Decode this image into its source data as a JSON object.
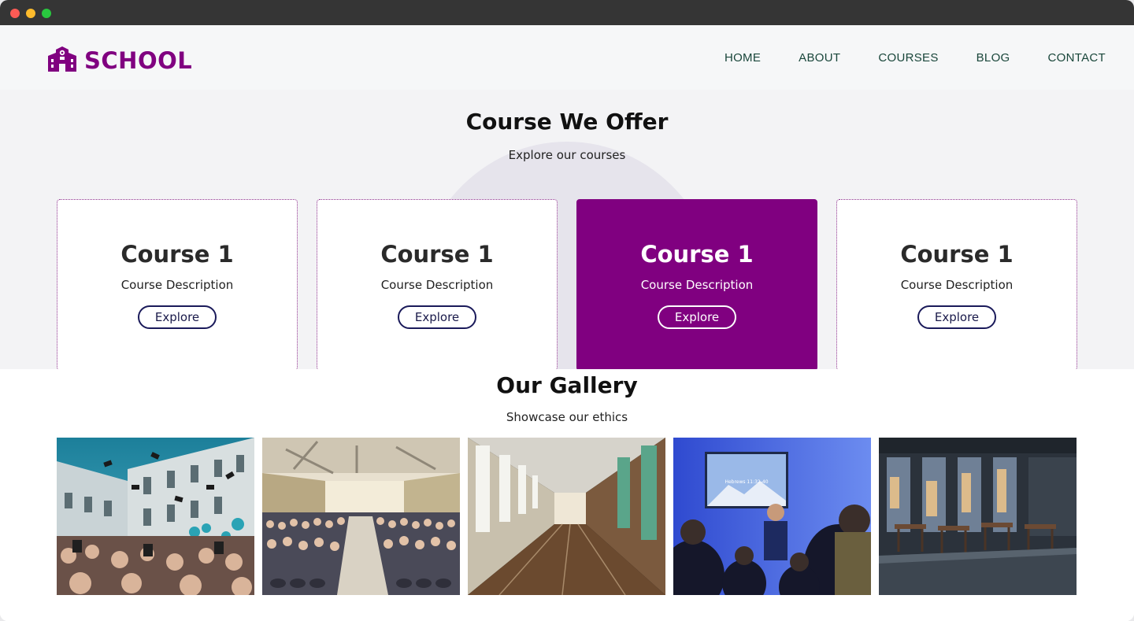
{
  "header": {
    "logo_text": "SCHOOL",
    "nav": [
      "HOME",
      "ABOUT",
      "COURSES",
      "BLOG",
      "CONTACT"
    ]
  },
  "courses": {
    "title": "Course We Offer",
    "subtitle": "Explore our courses",
    "cards": [
      {
        "title": "Course 1",
        "description": "Course Description",
        "button": "Explore",
        "active": false
      },
      {
        "title": "Course 1",
        "description": "Course Description",
        "button": "Explore",
        "active": false
      },
      {
        "title": "Course 1",
        "description": "Course Description",
        "button": "Explore",
        "active": true
      },
      {
        "title": "Course 1",
        "description": "Course Description",
        "button": "Explore",
        "active": false
      }
    ]
  },
  "gallery": {
    "title": "Our Gallery",
    "subtitle": "Showcase our ethics",
    "photos": [
      {
        "name": "graduation-photo",
        "slide_text": ""
      },
      {
        "name": "auditorium-photo",
        "slide_text": ""
      },
      {
        "name": "hallway-photo",
        "slide_text": ""
      },
      {
        "name": "presentation-photo",
        "slide_text": "Hebrews 11:32-40"
      },
      {
        "name": "classroom-photo",
        "slide_text": ""
      }
    ]
  },
  "colors": {
    "brand": "#800080",
    "nav_text": "#19463a",
    "button_border": "#1a1a5a"
  }
}
